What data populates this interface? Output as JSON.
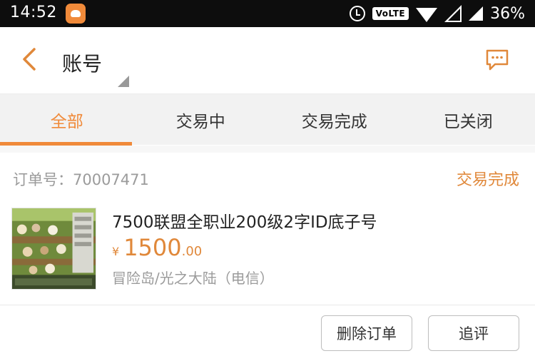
{
  "status_bar": {
    "time": "14:52",
    "volte": "VoLTE",
    "battery": "36%"
  },
  "header": {
    "title": "账号"
  },
  "tabs": [
    {
      "label": "全部",
      "active": true
    },
    {
      "label": "交易中",
      "active": false
    },
    {
      "label": "交易完成",
      "active": false
    },
    {
      "label": "已关闭",
      "active": false
    }
  ],
  "order": {
    "number_label": "订单号：",
    "number": "70007471",
    "status": "交易完成",
    "title": "7500联盟全职业200级2字ID底子号",
    "price_currency": "¥",
    "price_integer": "1500",
    "price_decimal": ".00",
    "meta": "冒险岛/光之大陆（电信）",
    "buttons": {
      "delete": "删除订单",
      "review": "追评"
    }
  },
  "colors": {
    "accent": "#f08a3a",
    "status_bar_bg": "#0d0d0d",
    "tab_bg": "#f2f2f2"
  }
}
